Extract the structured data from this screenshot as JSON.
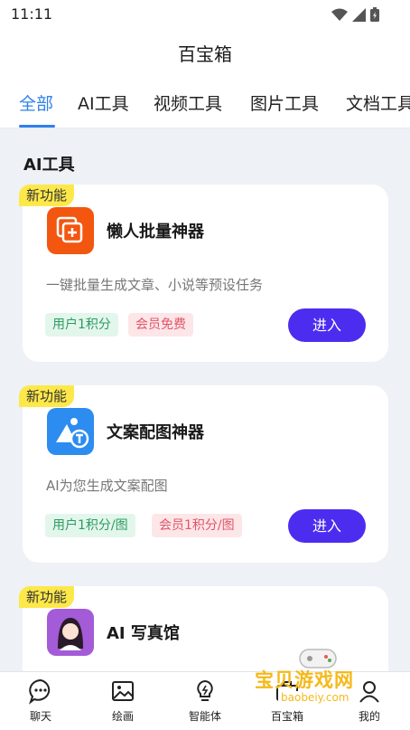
{
  "status": {
    "time": "11:11"
  },
  "header": {
    "title": "百宝箱"
  },
  "tabs": [
    {
      "label": "全部"
    },
    {
      "label": "AI工具"
    },
    {
      "label": "视频工具"
    },
    {
      "label": "图片工具"
    },
    {
      "label": "文档工具"
    }
  ],
  "section": {
    "title": "AI工具"
  },
  "cards": [
    {
      "badge": "新功能",
      "title": "懒人批量神器",
      "desc": "一键批量生成文章、小说等预设任务",
      "tag_user": "用户1积分",
      "tag_vip": "会员免费",
      "button": "进入",
      "icon": "batch-icon",
      "icon_color": "#f2560f"
    },
    {
      "badge": "新功能",
      "title": "文案配图神器",
      "desc": "AI为您生成文案配图",
      "tag_user": "用户1积分/图",
      "tag_vip": "会员1积分/图",
      "button": "进入",
      "icon": "image-text-icon",
      "icon_color": "#2d8cf0"
    },
    {
      "badge": "新功能",
      "title": "AI 写真馆",
      "icon": "portrait-icon",
      "icon_color": "#a35bd8"
    }
  ],
  "bottom_nav": [
    {
      "label": "聊天",
      "icon": "chat-icon"
    },
    {
      "label": "绘画",
      "icon": "image-icon"
    },
    {
      "label": "智能体",
      "icon": "bulb-icon"
    },
    {
      "label": "百宝箱",
      "icon": "toolbox-icon"
    },
    {
      "label": "我的",
      "icon": "user-icon"
    }
  ],
  "watermark": {
    "text": "宝贝游戏网",
    "url": "baobeiy.com"
  },
  "colors": {
    "accent": "#2f80ed",
    "button": "#4c2df0",
    "badge": "#fde84a",
    "background": "#eef1f6"
  }
}
